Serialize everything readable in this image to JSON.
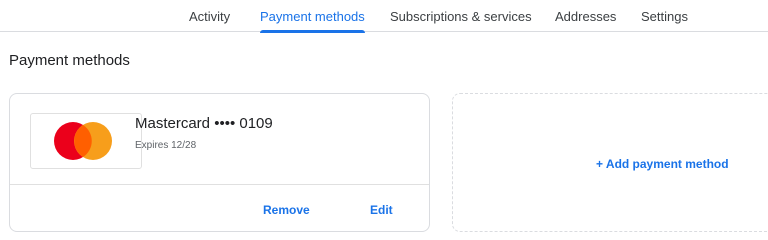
{
  "nav": {
    "tabs": [
      {
        "label": "Activity",
        "active": false
      },
      {
        "label": "Payment methods",
        "active": true
      },
      {
        "label": "Subscriptions & services",
        "active": false
      },
      {
        "label": "Addresses",
        "active": false
      },
      {
        "label": "Settings",
        "active": false
      }
    ]
  },
  "page": {
    "title": "Payment methods"
  },
  "card": {
    "brand_icon": "mastercard-logo",
    "name": "Mastercard •••• 0109",
    "expiry": "Expires 12/28",
    "remove_label": "Remove",
    "edit_label": "Edit"
  },
  "add_method": {
    "label": "+ Add payment method"
  },
  "colors": {
    "accent": "#1a73e8",
    "mastercard_red": "#eb001b",
    "mastercard_orange": "#f79e1b",
    "mastercard_overlap": "#ff5f00"
  }
}
